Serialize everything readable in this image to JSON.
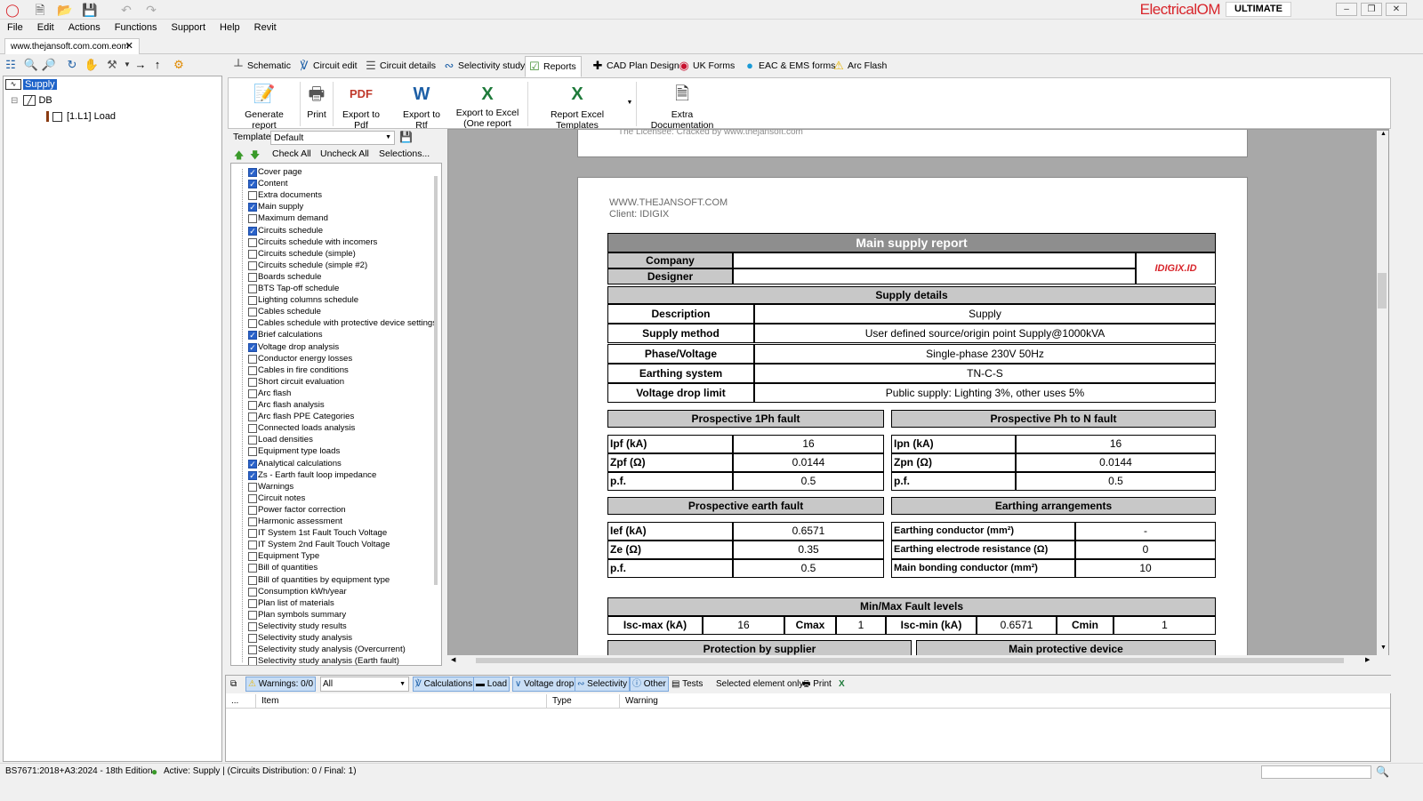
{
  "app": {
    "brand": "ElectricalOM",
    "edition": "ULTIMATE"
  },
  "menu": [
    "File",
    "Edit",
    "Actions",
    "Functions",
    "Support",
    "Help",
    "Revit"
  ],
  "doc_tab": "www.thejansoft.com.com.eom",
  "tree": {
    "root": "Supply",
    "db": "DB",
    "load": "[1.L1] Load"
  },
  "main_tabs": [
    "Schematic",
    "Circuit edit",
    "Circuit details",
    "Selectivity study",
    "Reports",
    "CAD Plan Design",
    "UK Forms",
    "EAC & EMS forms",
    "Arc Flash"
  ],
  "ribbon": {
    "generate": "Generate report",
    "print": "Print",
    "pdf": "Export to Pdf",
    "rtf": "Export to Rtf",
    "excel1": "Export to Excel",
    "excel2": "(One report item)",
    "templates": "Report Excel Templates",
    "extra": "Extra Documentation"
  },
  "template": {
    "label": "Template",
    "value": "Default",
    "check_all": "Check All",
    "uncheck_all": "Uncheck All",
    "selections": "Selections..."
  },
  "checklist": [
    {
      "label": "Cover page",
      "checked": true
    },
    {
      "label": "Content",
      "checked": true
    },
    {
      "label": "Extra documents",
      "checked": false
    },
    {
      "label": "Main supply",
      "checked": true
    },
    {
      "label": "Maximum demand",
      "checked": false
    },
    {
      "label": "Circuits schedule",
      "checked": true
    },
    {
      "label": "Circuits schedule with incomers",
      "checked": false
    },
    {
      "label": "Circuits schedule (simple)",
      "checked": false
    },
    {
      "label": "Circuits schedule (simple #2)",
      "checked": false
    },
    {
      "label": "Boards schedule",
      "checked": false
    },
    {
      "label": "BTS Tap-off schedule",
      "checked": false
    },
    {
      "label": "Lighting columns schedule",
      "checked": false
    },
    {
      "label": "Cables schedule",
      "checked": false
    },
    {
      "label": "Cables schedule with protective device settings",
      "checked": false
    },
    {
      "label": "Brief calculations",
      "checked": true
    },
    {
      "label": "Voltage drop analysis",
      "checked": true
    },
    {
      "label": "Conductor energy losses",
      "checked": false
    },
    {
      "label": "Cables in fire conditions",
      "checked": false
    },
    {
      "label": "Short circuit evaluation",
      "checked": false
    },
    {
      "label": "Arc flash",
      "checked": false
    },
    {
      "label": "Arc flash analysis",
      "checked": false
    },
    {
      "label": "Arc flash PPE Categories",
      "checked": false
    },
    {
      "label": "Connected loads analysis",
      "checked": false
    },
    {
      "label": "Load densities",
      "checked": false
    },
    {
      "label": "Equipment type loads",
      "checked": false
    },
    {
      "label": "Analytical calculations",
      "checked": true
    },
    {
      "label": "Zs - Earth fault loop impedance",
      "checked": true
    },
    {
      "label": "Warnings",
      "checked": false
    },
    {
      "label": "Circuit notes",
      "checked": false
    },
    {
      "label": "Power factor correction",
      "checked": false
    },
    {
      "label": "Harmonic assessment",
      "checked": false
    },
    {
      "label": "IT System 1st Fault Touch Voltage",
      "checked": false
    },
    {
      "label": "IT System 2nd Fault Touch Voltage",
      "checked": false
    },
    {
      "label": "Equipment Type",
      "checked": false
    },
    {
      "label": "Bill of quantities",
      "checked": false
    },
    {
      "label": "Bill of quantities by equipment type",
      "checked": false
    },
    {
      "label": "Consumption kWh/year",
      "checked": false
    },
    {
      "label": "Plan list of materials",
      "checked": false
    },
    {
      "label": "Plan symbols summary",
      "checked": false
    },
    {
      "label": "Selectivity study results",
      "checked": false
    },
    {
      "label": "Selectivity study analysis",
      "checked": false
    },
    {
      "label": "Selectivity study analysis (Overcurrent)",
      "checked": false
    },
    {
      "label": "Selectivity study analysis (Earth fault)",
      "checked": false
    }
  ],
  "report": {
    "prev_footer": "The Licensee: Cracked by www.thejansoft.com",
    "hdr1": "WWW.THEJANSOFT.COM",
    "hdr2": "Client: IDIGIX",
    "title": "Main supply report",
    "company": "Company",
    "designer": "Designer",
    "logo": "IDIGIX.ID",
    "supply_details": "Supply details",
    "rows": [
      {
        "k": "Description",
        "v": "Supply"
      },
      {
        "k": "Supply method",
        "v": "User defined source/origin point Supply@1000kVA"
      },
      {
        "k": "Phase/Voltage",
        "v": "Single-phase 230V 50Hz"
      },
      {
        "k": "Earthing system",
        "v": "TN-C-S"
      },
      {
        "k": "Voltage drop limit",
        "v": "Public supply: Lighting 3%, other uses 5%"
      }
    ],
    "p1ph": {
      "title": "Prospective 1Ph fault",
      "rows": [
        {
          "k": "Ipf (kA)",
          "v": "16"
        },
        {
          "k": "Zpf (Ω)",
          "v": "0.0144"
        },
        {
          "k": "p.f.",
          "v": "0.5"
        }
      ]
    },
    "pphn": {
      "title": "Prospective Ph to N fault",
      "rows": [
        {
          "k": "Ipn (kA)",
          "v": "16"
        },
        {
          "k": "Zpn (Ω)",
          "v": "0.0144"
        },
        {
          "k": "p.f.",
          "v": "0.5"
        }
      ]
    },
    "pef": {
      "title": "Prospective earth fault",
      "rows": [
        {
          "k": "Ief (kA)",
          "v": "0.6571"
        },
        {
          "k": "Ze (Ω)",
          "v": "0.35"
        },
        {
          "k": "p.f.",
          "v": "0.5"
        }
      ]
    },
    "earth": {
      "title": "Earthing arrangements",
      "rows": [
        {
          "k": "Earthing conductor (mm²)",
          "v": "-"
        },
        {
          "k": "Earthing electrode resistance (Ω)",
          "v": "0"
        },
        {
          "k": "Main bonding conductor (mm²)",
          "v": "10"
        }
      ]
    },
    "minmax": {
      "title": "Min/Max Fault levels",
      "iscmax_k": "Isc-max (kA)",
      "iscmax_v": "16",
      "cmax_k": "Cmax",
      "cmax_v": "1",
      "iscmin_k": "Isc-min (kA)",
      "iscmin_v": "0.6571",
      "cmin_k": "Cmin",
      "cmin_v": "1"
    },
    "prot_supplier": "Protection by supplier",
    "main_device": "Main protective device"
  },
  "bottom": {
    "warnings": "Warnings: 0/0",
    "filter": "All",
    "calc": "Calculations",
    "load": "Load",
    "vdrop": "Voltage drop",
    "selectivity": "Selectivity",
    "other": "Other",
    "tests": "Tests",
    "selected_only": "Selected element only",
    "print": "Print",
    "cols": [
      "...",
      "Item",
      "Type",
      "Warning"
    ]
  },
  "status": {
    "standard": "BS7671:2018+A3:2024 - 18th Edition",
    "active": "Active: Supply | (Circuits Distribution: 0 / Final: 1)"
  }
}
